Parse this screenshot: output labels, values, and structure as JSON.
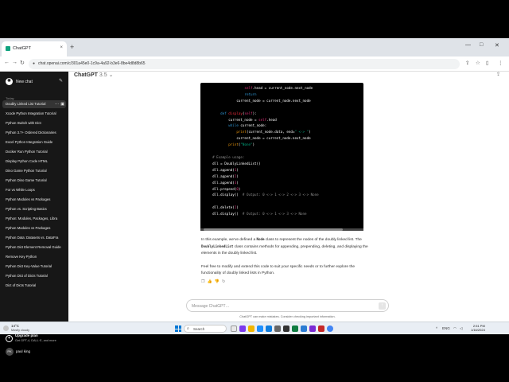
{
  "browser": {
    "tab_title": "ChatGPT",
    "tab_close": "×",
    "new_tab": "+",
    "url": "chat.openai.com/c/301a45e0-1c9a-4a92-b3e6-8be4d8d8b65",
    "win_min": "—",
    "win_max": "□",
    "win_close": "✕"
  },
  "sidebar": {
    "new_chat": "New chat",
    "section": "Today",
    "items": [
      "Doubly Linked List Tutorial",
      "Xcode Python Integration Tutorial",
      "Python Switch with Dict",
      "Python 3.7+ Ordered Dictionaries",
      "Excel Python Integration Guide",
      "Docker Run Python Tutorial",
      "Display Python Code HTML",
      "Dino Game Python Tutorial",
      "Python Dino Game Tutorial",
      "For vs While Loops",
      "Python Modules vs Packages",
      "Python vs. Scripting Basics",
      "Python: Modules, Packages, Libra",
      "Python Modules vs Packages",
      "Python Data: Datasets vs. DataFra",
      "Python Dict Element Removal Guide",
      "Remove Key Python",
      "Python Dict Key-Value Tutorial",
      "Python Dict of Dicts Tutorial",
      "Dict of Dicts Tutorial"
    ],
    "item_dots": "···",
    "upgrade_title": "Upgrade plan",
    "upgrade_sub": "Get GPT-4, DALL·E, and more",
    "user_initials": "PK",
    "user_name": "paul king"
  },
  "header": {
    "model": "ChatGPT",
    "version": "3.5",
    "caret": "⌄"
  },
  "message": {
    "para1_a": "In this example, we've defined a ",
    "para1_code1": "Node",
    "para1_b": " class to represent the nodes of the doubly linked list. The ",
    "para1_code2": "DoublyLinkedList",
    "para1_c": " class contains methods for appending, prepending, deleting, and displaying the elements in the doubly linked list.",
    "para2": "Feel free to modify and extend this code to suit your specific needs or to further explore the functionality of doubly linked lists in Python."
  },
  "composer": {
    "placeholder": "Message ChatGPT…",
    "disclaimer": "ChatGPT can make mistakes. Consider checking important information.",
    "help": "?"
  },
  "taskbar": {
    "temp": "14°C",
    "condition": "Mostly cloudy",
    "search": "Search",
    "time": "2:51 PM",
    "date": "1/16/2024",
    "lang": "ENG"
  },
  "colors": {
    "sidebar_bg": "#171717",
    "code_bg": "#000000",
    "accent": "#10a37f"
  }
}
